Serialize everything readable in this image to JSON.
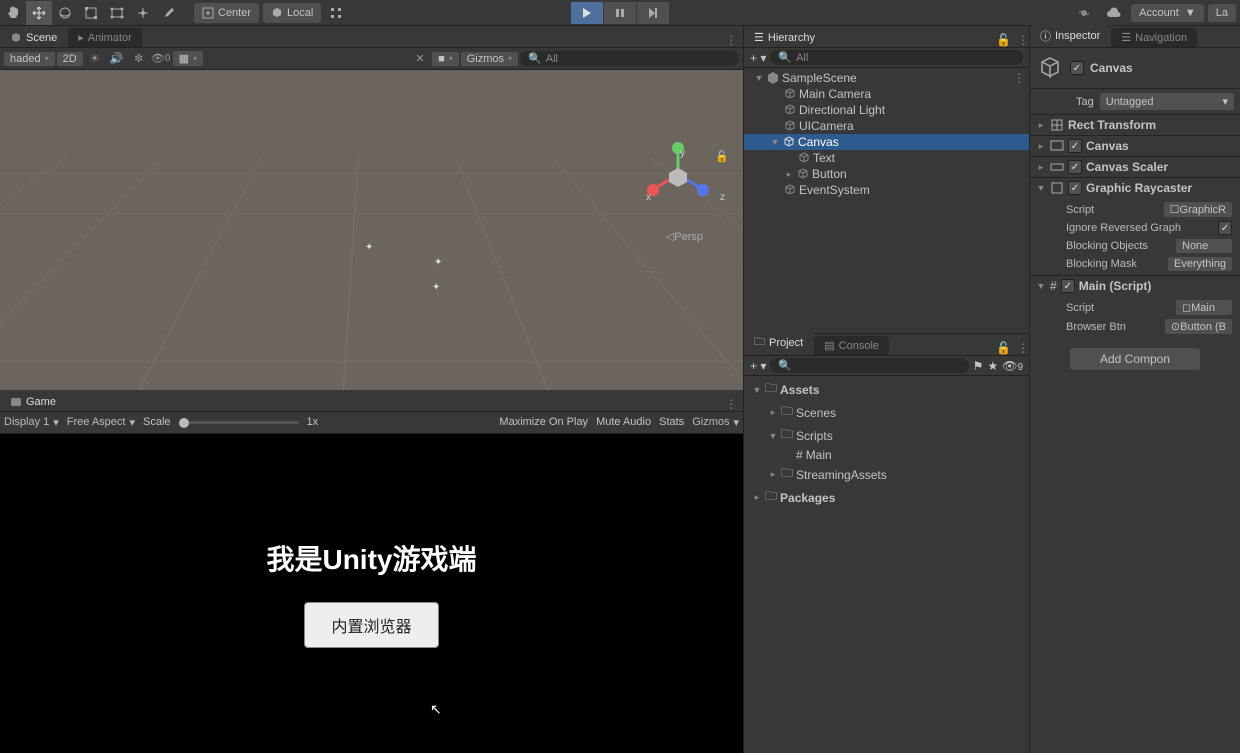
{
  "toolbar": {
    "center_label": "Center",
    "local_label": "Local",
    "account_label": "Account",
    "la_label": "La"
  },
  "scene": {
    "tab_scene": "Scene",
    "tab_animator": "Animator",
    "shading": "haded",
    "mode_2d": "2D",
    "hidden_count": "0",
    "gizmos_label": "Gizmos",
    "search_placeholder": "All",
    "axis_x": "x",
    "axis_y": "y",
    "axis_z": "z",
    "persp": "Persp"
  },
  "game": {
    "tab_game": "Game",
    "display": "Display 1",
    "aspect": "Free Aspect",
    "scale_label": "Scale",
    "scale_val": "1x",
    "max_on_play": "Maximize On Play",
    "mute": "Mute Audio",
    "stats": "Stats",
    "gizmos": "Gizmos",
    "text": "我是Unity游戏端",
    "button": "内置浏览器"
  },
  "hierarchy": {
    "title": "Hierarchy",
    "search_placeholder": "All",
    "scene_name": "SampleScene",
    "items": [
      "Main Camera",
      "Directional Light",
      "UICamera",
      "Canvas",
      "Text",
      "Button",
      "EventSystem"
    ]
  },
  "project": {
    "tab_project": "Project",
    "tab_console": "Console",
    "hidden_badge": "9",
    "assets": "Assets",
    "scenes": "Scenes",
    "scripts": "Scripts",
    "main_script": "Main",
    "streaming": "StreamingAssets",
    "packages": "Packages"
  },
  "inspector": {
    "tab_inspector": "Inspector",
    "tab_navigation": "Navigation",
    "object_name": "Canvas",
    "tag_label": "Tag",
    "tag_value": "Untagged",
    "rect_transform": "Rect Transform",
    "canvas": "Canvas",
    "canvas_scaler": "Canvas Scaler",
    "graphic_raycaster": "Graphic Raycaster",
    "script_label": "Script",
    "script_value": "GraphicR",
    "ignore_reversed": "Ignore Reversed Graph",
    "blocking_objects": "Blocking Objects",
    "blocking_objects_val": "None",
    "blocking_mask": "Blocking Mask",
    "blocking_mask_val": "Everything",
    "main_script": "Main (Script)",
    "main_script_val": "Main",
    "browser_btn": "Browser Btn",
    "browser_btn_val": "Button (B",
    "add_component": "Add Compon"
  }
}
